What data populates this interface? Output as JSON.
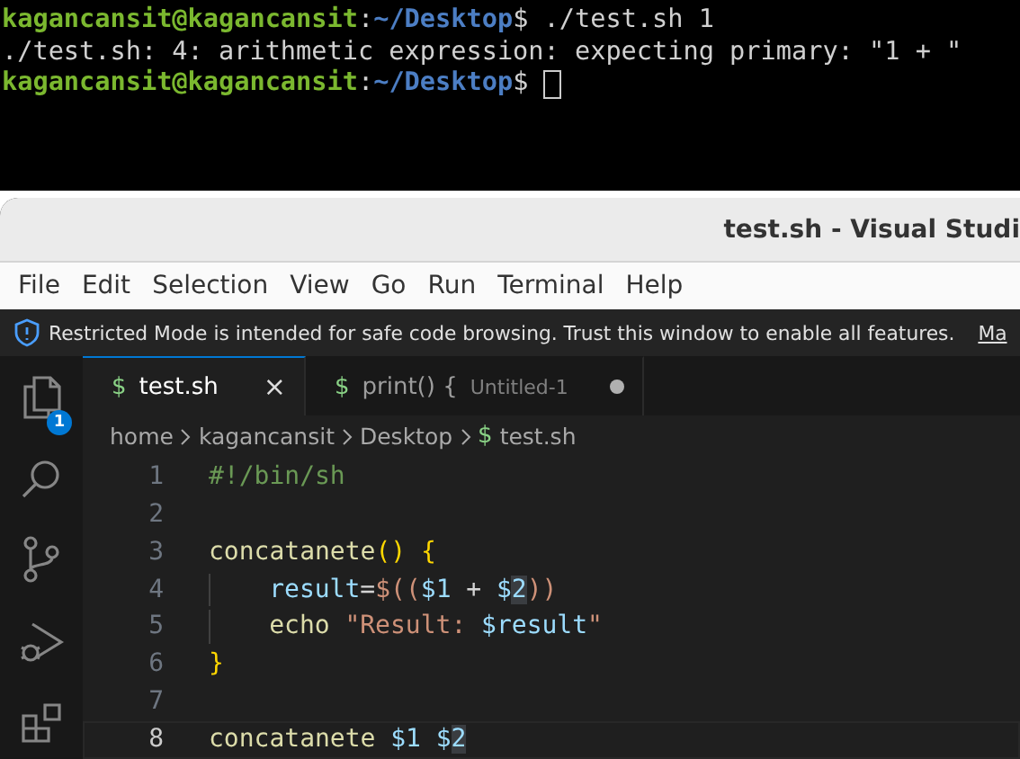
{
  "terminal": {
    "lines": [
      [
        {
          "kind": "user",
          "text": "kagancansit@kagancansit"
        },
        {
          "kind": "plain",
          "text": ":"
        },
        {
          "kind": "path",
          "text": "~/Desktop"
        },
        {
          "kind": "plain",
          "text": "$ ./test.sh 1"
        }
      ],
      [
        {
          "kind": "plain",
          "text": "./test.sh: 4: arithmetic expression: expecting primary: \"1 + \""
        }
      ],
      [
        {
          "kind": "user",
          "text": "kagancansit@kagancansit"
        },
        {
          "kind": "plain",
          "text": ":"
        },
        {
          "kind": "path",
          "text": "~/Desktop"
        },
        {
          "kind": "plain",
          "text": "$ "
        },
        {
          "kind": "cursor"
        }
      ]
    ]
  },
  "window": {
    "title": "test.sh - Visual Studi"
  },
  "menu": [
    "File",
    "Edit",
    "Selection",
    "View",
    "Go",
    "Run",
    "Terminal",
    "Help"
  ],
  "banner": {
    "text": "Restricted Mode is intended for safe code browsing. Trust this window to enable all features.",
    "link": "Ma"
  },
  "activity_bar": [
    {
      "kind": "files",
      "badge": "1"
    },
    {
      "kind": "search"
    },
    {
      "kind": "source-control"
    },
    {
      "kind": "run-debug"
    },
    {
      "kind": "extensions"
    }
  ],
  "tabs": [
    {
      "icon": "$",
      "label": "test.sh",
      "selected": true,
      "dirty": false,
      "close": "×"
    },
    {
      "icon": "$",
      "label": "print() {",
      "description": "Untitled-1",
      "selected": false,
      "dirty": true
    }
  ],
  "breadcrumb": [
    "home",
    "kagancansit",
    "Desktop",
    "test.sh"
  ],
  "breadcrumb_file_icon": "$",
  "editor": {
    "lines": [
      {
        "number": "1",
        "current": false,
        "indented": false,
        "tokens": [
          {
            "kind": "comment",
            "text": "#!/bin/sh"
          }
        ]
      },
      {
        "number": "2",
        "current": false
      },
      {
        "number": "3",
        "current": false,
        "indented": false,
        "tokens": [
          {
            "kind": "func",
            "text": "concatanete"
          },
          {
            "kind": "bracket",
            "text": "() {"
          }
        ]
      },
      {
        "number": "4",
        "current": false,
        "indented": true,
        "tokens": [
          {
            "kind": "var",
            "text": "result"
          },
          {
            "kind": "op",
            "text": "="
          },
          {
            "kind": "string",
            "text": "$(("
          },
          {
            "kind": "var",
            "text": "$1"
          },
          {
            "kind": "op",
            "text": "+"
          },
          {
            "kind": "var",
            "text": "$"
          },
          {
            "kind": "var-hl",
            "text": "2"
          },
          {
            "kind": "string",
            "text": "))"
          }
        ]
      },
      {
        "number": "5",
        "current": false,
        "indented": true,
        "tokens": [
          {
            "kind": "func",
            "text": "echo"
          },
          {
            "kind": "string",
            "text": "\"Result:"
          },
          {
            "kind": "var",
            "text": "$result"
          },
          {
            "kind": "string",
            "text": "\""
          }
        ]
      },
      {
        "number": "6",
        "current": false,
        "indented": false,
        "tokens": [
          {
            "kind": "bracket",
            "text": "}"
          }
        ]
      },
      {
        "number": "7",
        "current": false
      },
      {
        "number": "8",
        "current": true,
        "indented": false,
        "tokens": [
          {
            "kind": "func",
            "text": "concatanete"
          },
          {
            "kind": "var",
            "text": "$1"
          },
          {
            "kind": "var",
            "text": "$"
          },
          {
            "kind": "var-hl",
            "text": "2"
          }
        ]
      }
    ]
  }
}
